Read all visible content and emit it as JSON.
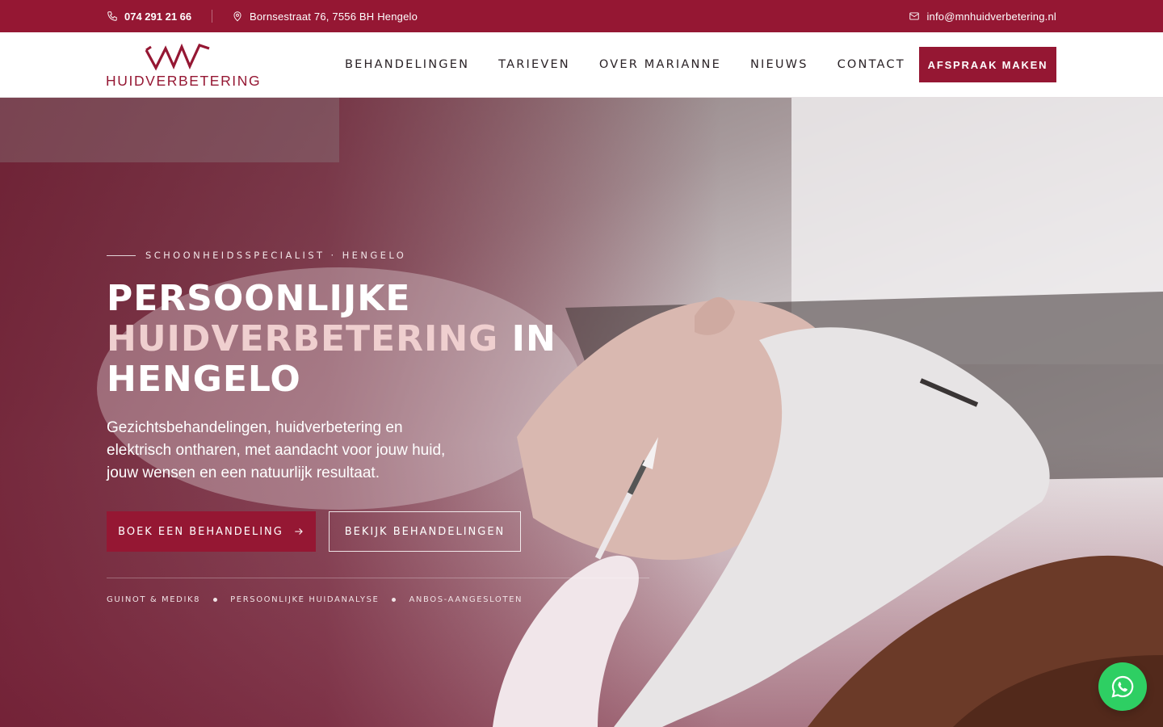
{
  "topbar": {
    "phone": "074 291 21 66",
    "address": "Bornsestraat 76, 7556 BH Hengelo",
    "email": "info@mnhuidverbetering.nl",
    "icons": [
      "phone-icon",
      "location-pin-icon",
      "mail-icon"
    ]
  },
  "header": {
    "logo_text": "HUIDVERBETERING",
    "nav": [
      "BEHANDELINGEN",
      "TARIEVEN",
      "OVER MARIANNE",
      "NIEUWS",
      "CONTACT"
    ],
    "cta_label": "AFSPRAAK MAKEN"
  },
  "hero": {
    "eyebrow": "SCHOONHEIDSSPECIALIST · HENGELO",
    "headline": {
      "line1": "PERSOONLIJKE",
      "accent": "HUIDVERBETERING",
      "line2_rest": " IN",
      "line3": "HENGELO"
    },
    "lead": "Gezichtsbehandelingen, huidverbetering en elektrisch ontharen, met aandacht voor jouw huid, jouw wensen en een natuurlijk resultaat.",
    "primary_button": "BOEK EEN BEHANDELING",
    "secondary_button": "BEKIJK BEHANDELINGEN",
    "features": [
      "GUINOT & MEDIK8",
      "PERSOONLIJKE HUIDANALYSE",
      "ANBOS-AANGESLOTEN"
    ]
  },
  "colors": {
    "brand": "#951733",
    "accent_text": "#efcfcf",
    "whatsapp": "#2ecf63"
  }
}
